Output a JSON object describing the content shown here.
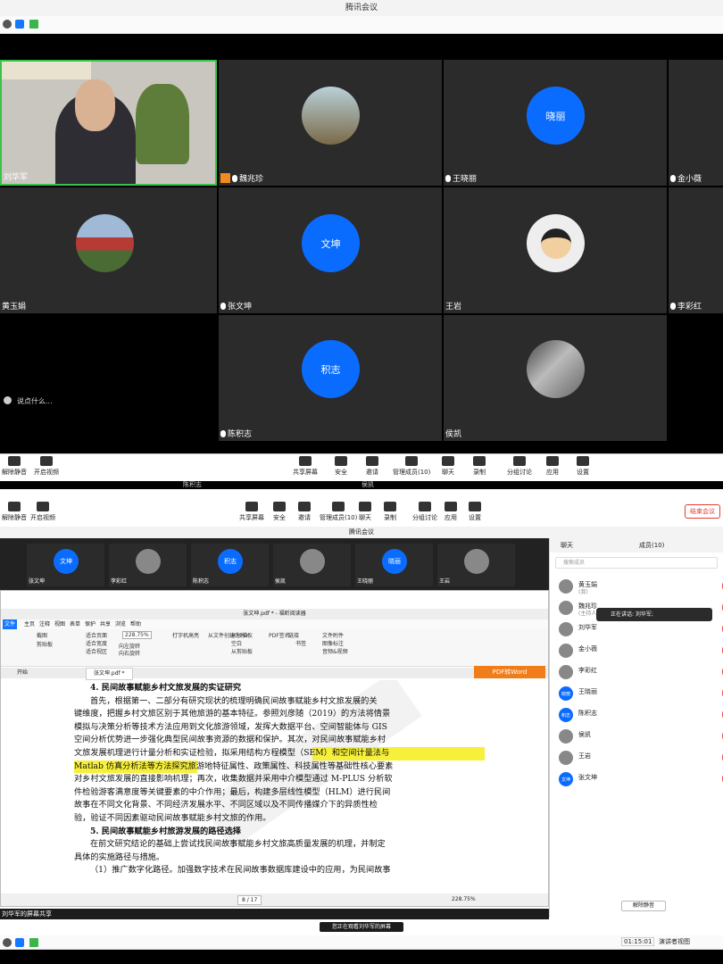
{
  "app": {
    "title": "腾讯会议"
  },
  "gallery": {
    "tiles": [
      {
        "name": "刘华军",
        "kind": "video"
      },
      {
        "name": "魏兆珍",
        "kind": "photo"
      },
      {
        "name": "王晓丽",
        "kind": "text-avatar",
        "avatar_text": "晓丽"
      },
      {
        "name": "金小薇",
        "kind": "none"
      },
      {
        "name": "黄玉娟",
        "kind": "photo"
      },
      {
        "name": "张文坤",
        "kind": "text-avatar",
        "avatar_text": "文坤"
      },
      {
        "name": "王岩",
        "kind": "cartoon"
      },
      {
        "name": "李彩红",
        "kind": "none"
      },
      {
        "name": "陈积志",
        "kind": "text-avatar",
        "avatar_text": "积志"
      },
      {
        "name": "侯凯",
        "kind": "photo"
      }
    ],
    "chat_placeholder": "说点什么..."
  },
  "toolbar": {
    "mute": "解除静音",
    "video": "开启视频",
    "items": [
      "共享屏幕",
      "安全",
      "邀请",
      "管理成员(10)",
      "聊天",
      "录制",
      "分组讨论",
      "应用",
      "设置"
    ]
  },
  "overlap": {
    "left": "陈积志",
    "right": "侯凯"
  },
  "bottom_window": {
    "end_meeting": "结束会议",
    "title": "腾讯会议",
    "thumbs": [
      {
        "name": "张文坤",
        "avatar_text": "文坤"
      },
      {
        "name": "李彩红",
        "avatar_text": ""
      },
      {
        "name": "陈积志",
        "avatar_text": "积志"
      },
      {
        "name": "侯凯",
        "avatar_text": ""
      },
      {
        "name": "王晓丽",
        "avatar_text": "晓丽"
      },
      {
        "name": "王岩",
        "avatar_text": ""
      }
    ],
    "share_label": "刘华军的屏幕共享",
    "viewing_label": "您正在观看刘华军的屏幕",
    "speaking": "正在讲话: 刘华军;"
  },
  "pdf": {
    "title": "张文坤.pdf * - 福昕阅读器",
    "tabs": [
      "开始",
      "主页",
      "注释",
      "视图",
      "表单",
      "保护",
      "共享",
      "浏览",
      "帮助"
    ],
    "file_tab": "张文坤.pdf *",
    "start_tab": "开始",
    "zoom": "228.75%",
    "page": "8 / 17",
    "pdf_to_word": "PDF转Word",
    "ribbon": [
      "截图",
      "剪贴板",
      "适合页面",
      "适合宽度",
      "适合视区",
      "向左旋转",
      "向右旋转",
      "打字机",
      "高亮",
      "从文件创建为PDF",
      "从扫描仪",
      "空白",
      "从剪贴板",
      "PDF签名",
      "链接",
      "书签",
      "文件附件",
      "图像标注",
      "音频&视频"
    ],
    "lines": [
      {
        "text": "4. 民间故事赋能乡村文旅发展的实证研究",
        "bold": true,
        "indent": 18
      },
      {
        "text": "首先，根据第一、二部分有研究现状的梳理明确民间故事赋能乡村文旅发展的关",
        "indent": 18
      },
      {
        "text": "键维度，把握乡村文旅区别于其他旅游的基本特征。参照刘彦随（2019）的方法将情景",
        "indent": 0
      },
      {
        "text": "模拟与决策分析等技术方法应用到文化旅游领域，发挥大数据平台、空间智能体与 GIS",
        "indent": 0
      },
      {
        "text": "空间分析优势进一步强化典型民间故事资源的数据和保护。其次，对民间故事赋能乡村",
        "indent": 0
      },
      {
        "text": "文旅发展机理进行计量分析和实证检验，拟采用结构方程模型（SEM）和空间计量法与",
        "indent": 0
      },
      {
        "text": "Matlab 仿真分析法等方法探究旅游地特征属性、政策属性、科技属性等基础性核心要素",
        "indent": 0
      },
      {
        "text": "对乡村文旅发展的直接影响机理；再次，收集数据并采用中介模型通过 M-PLUS 分析软",
        "indent": 0
      },
      {
        "text": "件检验游客满意度等关键要素的中介作用；最后，构建多层线性模型（HLM）进行民间",
        "indent": 0
      },
      {
        "text": "故事在不同文化背景、不同经济发展水平、不同区域以及不同传播媒介下的异质性检",
        "indent": 0
      },
      {
        "text": "验，验证不同因素驱动民间故事赋能乡村文旅的作用。",
        "indent": 0
      },
      {
        "text": "5. 民间故事赋能乡村旅游发展的路径选择",
        "bold": true,
        "indent": 18
      },
      {
        "text": "在前文研究结论的基础上尝试找民间故事赋能乡村文旅高质量发展的机理，并制定",
        "indent": 18
      },
      {
        "text": "具体的实施路径与措施。",
        "indent": 0
      },
      {
        "text": "（1）推广数字化路径。加强数字技术在民间故事数据库建设中的应用，为民间故事",
        "indent": 18
      }
    ]
  },
  "members": {
    "tab_chat": "聊天",
    "tab_members": "成员(10)",
    "search_placeholder": "搜索成员",
    "list": [
      {
        "name": "黄玉娟",
        "sub": "(我)"
      },
      {
        "name": "魏兆珍",
        "sub": "(主持人)"
      },
      {
        "name": "刘华军",
        "sub": ""
      },
      {
        "name": "金小薇",
        "sub": ""
      },
      {
        "name": "李彩红",
        "sub": ""
      },
      {
        "name": "王晓丽",
        "sub": "",
        "avatar_text": "晓丽"
      },
      {
        "name": "陈积志",
        "sub": "",
        "avatar_text": "积志"
      },
      {
        "name": "侯凯",
        "sub": ""
      },
      {
        "name": "王岩",
        "sub": ""
      },
      {
        "name": "张文坤",
        "sub": "",
        "avatar_text": "文坤"
      }
    ],
    "unmute_all": "解除静音"
  },
  "footer": {
    "clock": "01:15:01",
    "view": "演讲者视图"
  },
  "colors": {
    "accent": "#0a6cff",
    "danger": "#e53935",
    "highlight": "#f6f03a"
  }
}
